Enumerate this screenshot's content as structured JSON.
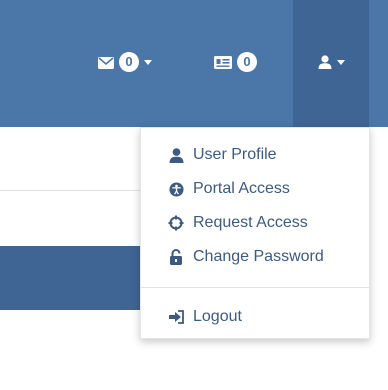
{
  "navbar": {
    "messages": {
      "count": "0",
      "icon": "envelope-icon"
    },
    "cards": {
      "count": "0",
      "icon": "id-card-icon"
    },
    "user": {
      "icon": "user-icon"
    }
  },
  "dropdown": {
    "items": [
      {
        "label": "User Profile",
        "icon": "user-icon"
      },
      {
        "label": "Portal Access",
        "icon": "universal-access-icon"
      },
      {
        "label": "Request Access",
        "icon": "crosshairs-icon"
      },
      {
        "label": "Change Password",
        "icon": "unlock-icon"
      },
      {
        "label": "Logout",
        "icon": "sign-out-icon"
      }
    ]
  },
  "colors": {
    "navbar": "#4a76a8",
    "navbar_active": "#3f6595",
    "menu_text": "#3c5a82"
  }
}
